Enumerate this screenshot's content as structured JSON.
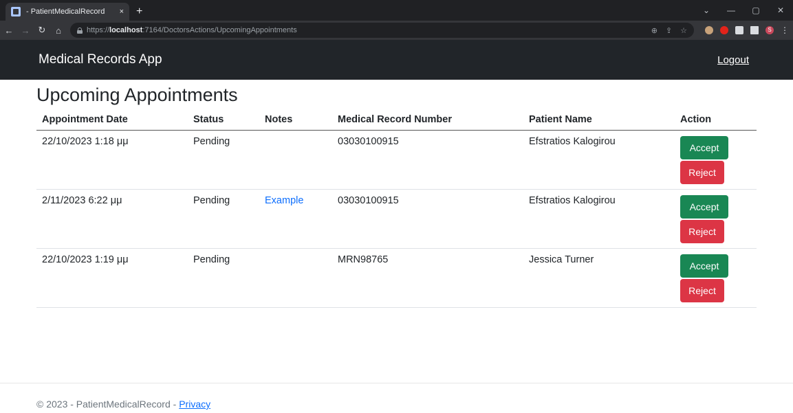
{
  "browser": {
    "tab_title": "- PatientMedicalRecord",
    "tab_close": "×",
    "new_tab": "+",
    "url_scheme": "https://",
    "url_host": "localhost",
    "url_path": ":7164/DoctorsActions/UpcomingAppointments",
    "profile_initial": "S"
  },
  "navbar": {
    "brand": "Medical Records App",
    "logout_label": "Logout"
  },
  "page": {
    "title": "Upcoming Appointments"
  },
  "table": {
    "headers": {
      "date": "Appointment Date",
      "status": "Status",
      "notes": "Notes",
      "mrn": "Medical Record Number",
      "patient": "Patient Name",
      "action": "Action"
    },
    "rows": [
      {
        "date": "22/10/2023 1:18 μμ",
        "status": "Pending",
        "notes": "",
        "mrn": "03030100915",
        "patient": "Efstratios Kalogirou",
        "accept": "Accept",
        "reject": "Reject"
      },
      {
        "date": "2/11/2023 6:22 μμ",
        "status": "Pending",
        "notes": "Example",
        "mrn": "03030100915",
        "patient": "Efstratios Kalogirou",
        "accept": "Accept",
        "reject": "Reject"
      },
      {
        "date": "22/10/2023 1:19 μμ",
        "status": "Pending",
        "notes": "",
        "mrn": "MRN98765",
        "patient": "Jessica Turner",
        "accept": "Accept",
        "reject": "Reject"
      }
    ]
  },
  "footer": {
    "text": "© 2023 - PatientMedicalRecord - ",
    "privacy_label": "Privacy"
  },
  "colors": {
    "navbar_bg": "#212529",
    "accept": "#198754",
    "reject": "#dc3545",
    "link": "#0d6efd"
  }
}
